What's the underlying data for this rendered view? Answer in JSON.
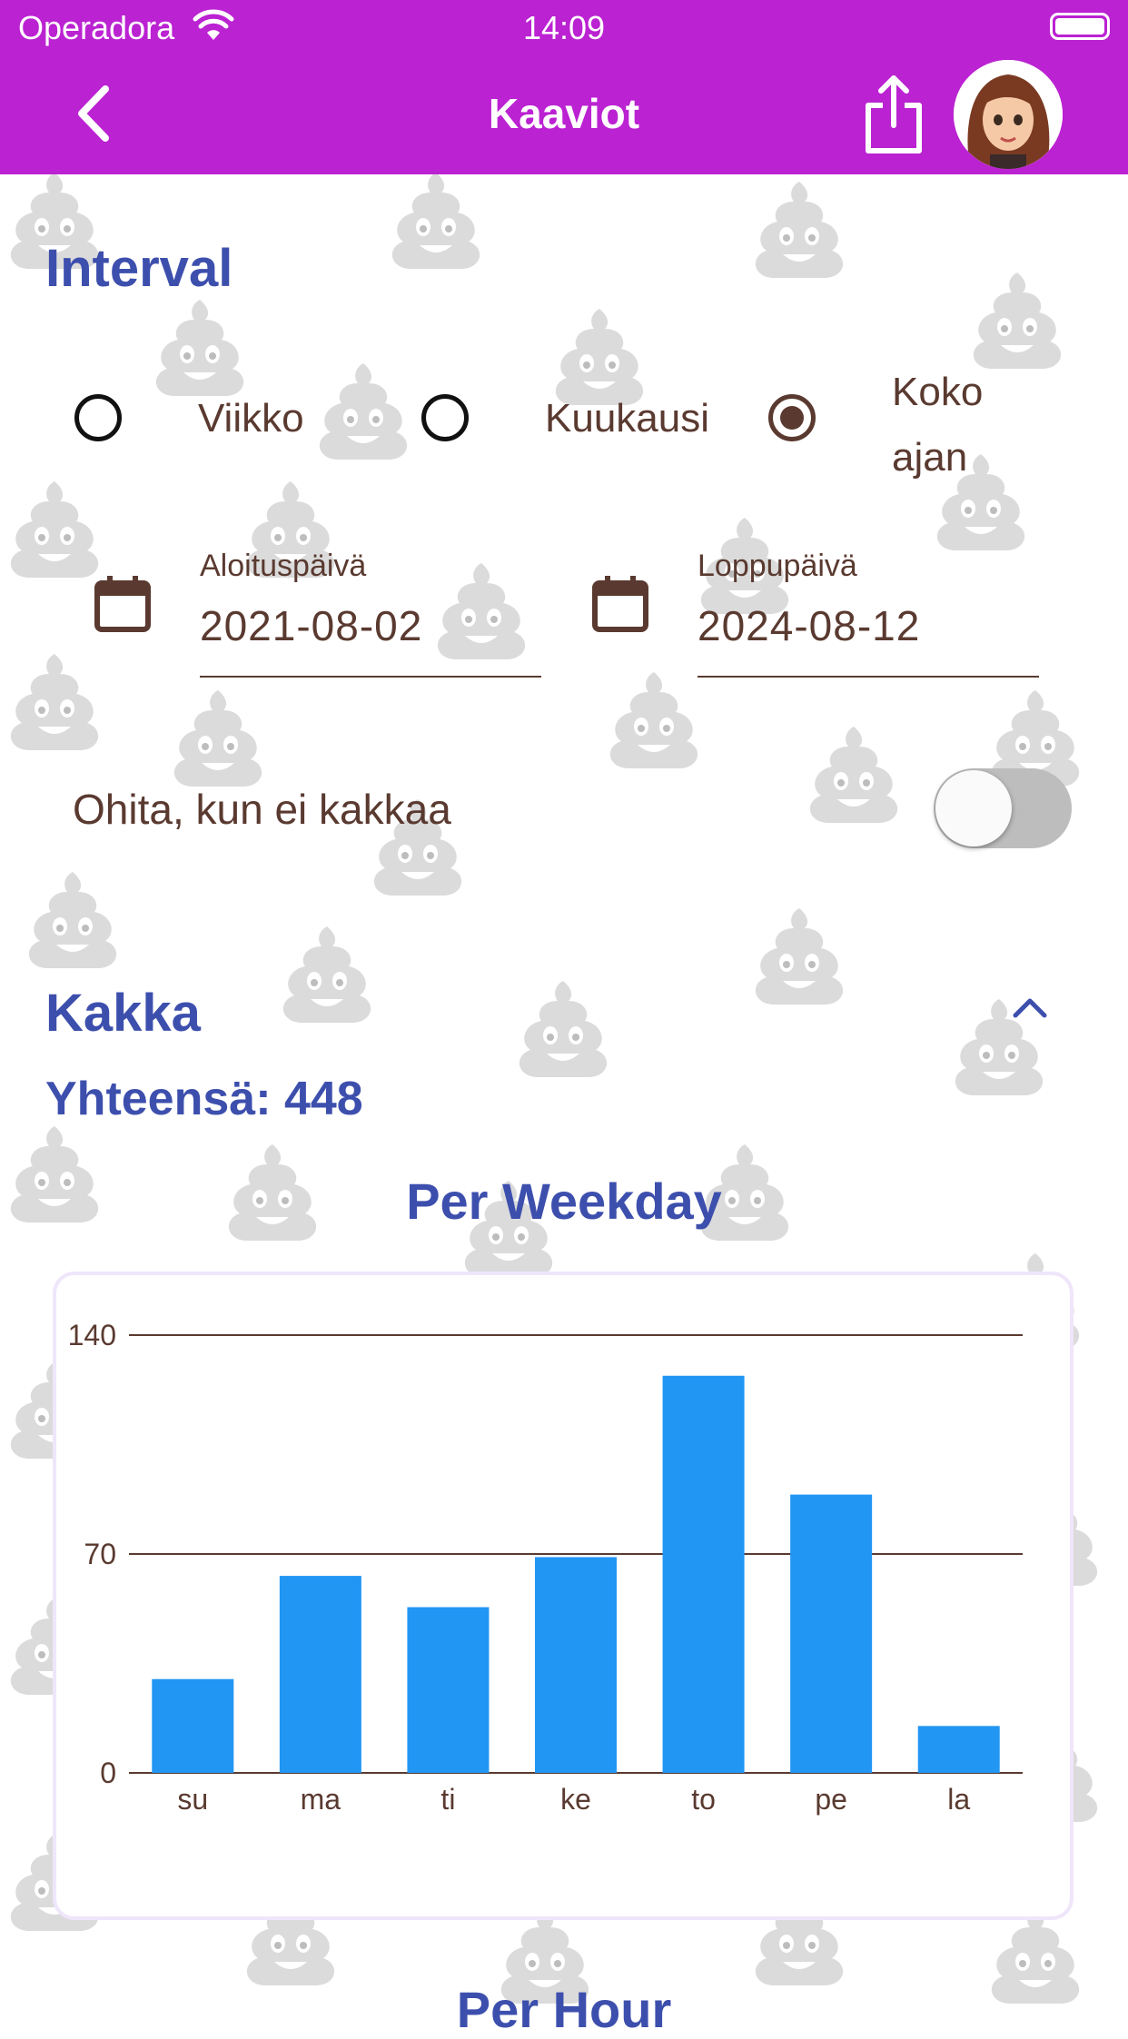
{
  "status_bar": {
    "carrier": "Operadora",
    "time": "14:09"
  },
  "app_bar": {
    "title": "Kaaviot",
    "accent_color": "#bb22d2"
  },
  "interval": {
    "title": "Interval",
    "options": [
      "Viikko",
      "Kuukausi",
      "Koko ajan"
    ],
    "selected": "Koko ajan"
  },
  "dates": {
    "start_label": "Aloituspäivä",
    "start_value": "2021-08-02",
    "end_label": "Loppupäivä",
    "end_value": "2024-08-12"
  },
  "toggle": {
    "label": "Ohita, kun ei kakkaa",
    "on": false
  },
  "kakka": {
    "title": "Kakka",
    "total": "Yhteensä: 448"
  },
  "chart_title": "Per Weekday",
  "chart_data": {
    "type": "bar",
    "categories": [
      "su",
      "ma",
      "ti",
      "ke",
      "to",
      "pe",
      "la"
    ],
    "values": [
      30,
      63,
      53,
      69,
      127,
      89,
      15
    ],
    "ylim": [
      0,
      140
    ],
    "yticks": [
      0,
      70,
      140
    ],
    "bar_color": "#2196f3",
    "grid": true
  },
  "next_section_title": "Per Hour"
}
